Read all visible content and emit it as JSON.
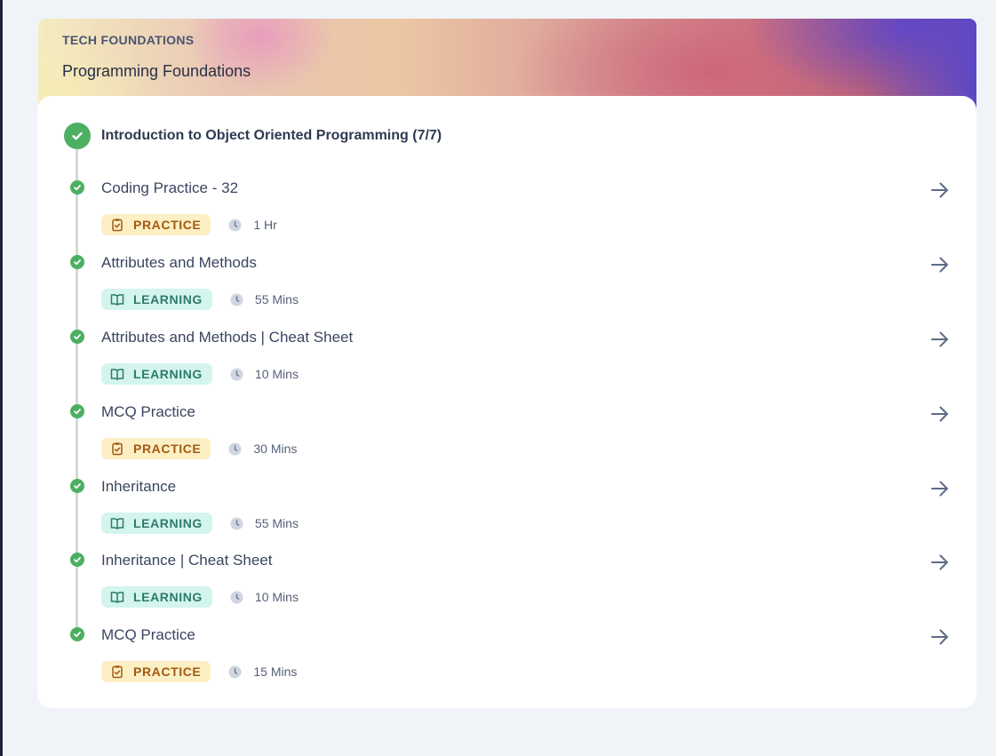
{
  "hero": {
    "eyebrow": "TECH FOUNDATIONS",
    "title": "Programming Foundations"
  },
  "module": {
    "title": "Introduction to Object Oriented Programming (7/7)",
    "status_icon": "check-circle-icon",
    "accent_color": "#4caf62"
  },
  "items": [
    {
      "title": "Coding Practice - 32",
      "tag": "PRACTICE",
      "tag_icon": "clipboard-check-icon",
      "duration": "1 Hr"
    },
    {
      "title": "Attributes and Methods",
      "tag": "LEARNING",
      "tag_icon": "book-open-icon",
      "duration": "55 Mins"
    },
    {
      "title": "Attributes and Methods | Cheat Sheet",
      "tag": "LEARNING",
      "tag_icon": "book-open-icon",
      "duration": "10 Mins"
    },
    {
      "title": "MCQ Practice",
      "tag": "PRACTICE",
      "tag_icon": "clipboard-check-icon",
      "duration": "30 Mins"
    },
    {
      "title": "Inheritance",
      "tag": "LEARNING",
      "tag_icon": "book-open-icon",
      "duration": "55 Mins"
    },
    {
      "title": "Inheritance | Cheat Sheet",
      "tag": "LEARNING",
      "tag_icon": "book-open-icon",
      "duration": "10 Mins"
    },
    {
      "title": "MCQ Practice",
      "tag": "PRACTICE",
      "tag_icon": "clipboard-check-icon",
      "duration": "15 Mins"
    }
  ],
  "colors": {
    "practice_bg": "#fcefc4",
    "practice_text": "#a25a13",
    "learning_bg": "#d3f5ee",
    "learning_text": "#2d7b6b",
    "complete_green": "#4caf62"
  }
}
